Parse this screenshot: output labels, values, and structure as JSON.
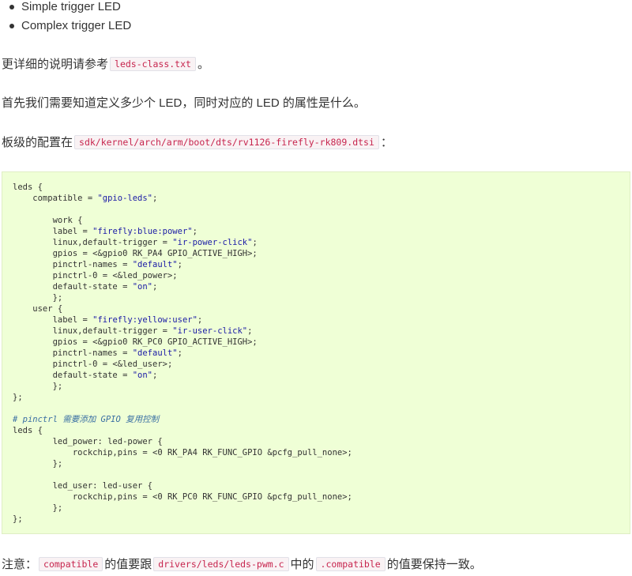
{
  "bullets": [
    "Simple trigger LED",
    "Complex trigger LED"
  ],
  "para1": {
    "before": "更详细的说明请参考",
    "code": "leds-class.txt",
    "after": "。"
  },
  "para2": {
    "text": "首先我们需要知道定义多少个 LED，同时对应的 LED 的属性是什么。"
  },
  "para3": {
    "before": "板级的配置在",
    "code": "sdk/kernel/arch/arm/boot/dts/rv1126-firefly-rk809.dtsi",
    "after": "："
  },
  "code_lines": [
    [
      {
        "t": "leds {",
        "c": ""
      }
    ],
    [
      {
        "t": "    compatible = ",
        "c": ""
      },
      {
        "t": "\"gpio-leds\"",
        "c": "str"
      },
      {
        "t": ";",
        "c": ""
      }
    ],
    [
      {
        "t": "",
        "c": ""
      }
    ],
    [
      {
        "t": "        work {",
        "c": ""
      }
    ],
    [
      {
        "t": "        label = ",
        "c": ""
      },
      {
        "t": "\"firefly:blue:power\"",
        "c": "str"
      },
      {
        "t": ";",
        "c": ""
      }
    ],
    [
      {
        "t": "        linux,default-trigger = ",
        "c": ""
      },
      {
        "t": "\"ir-power-click\"",
        "c": "str"
      },
      {
        "t": ";",
        "c": ""
      }
    ],
    [
      {
        "t": "        gpios = <&gpio0 RK_PA4 GPIO_ACTIVE_HIGH>;",
        "c": ""
      }
    ],
    [
      {
        "t": "        pinctrl-names = ",
        "c": ""
      },
      {
        "t": "\"default\"",
        "c": "str"
      },
      {
        "t": ";",
        "c": ""
      }
    ],
    [
      {
        "t": "        pinctrl-0 = <&led_power>;",
        "c": ""
      }
    ],
    [
      {
        "t": "        default-state = ",
        "c": ""
      },
      {
        "t": "\"on\"",
        "c": "str"
      },
      {
        "t": ";",
        "c": ""
      }
    ],
    [
      {
        "t": "        };",
        "c": ""
      }
    ],
    [
      {
        "t": "    user {",
        "c": ""
      }
    ],
    [
      {
        "t": "        label = ",
        "c": ""
      },
      {
        "t": "\"firefly:yellow:user\"",
        "c": "str"
      },
      {
        "t": ";",
        "c": ""
      }
    ],
    [
      {
        "t": "        linux,default-trigger = ",
        "c": ""
      },
      {
        "t": "\"ir-user-click\"",
        "c": "str"
      },
      {
        "t": ";",
        "c": ""
      }
    ],
    [
      {
        "t": "        gpios = <&gpio0 RK_PC0 GPIO_ACTIVE_HIGH>;",
        "c": ""
      }
    ],
    [
      {
        "t": "        pinctrl-names = ",
        "c": ""
      },
      {
        "t": "\"default\"",
        "c": "str"
      },
      {
        "t": ";",
        "c": ""
      }
    ],
    [
      {
        "t": "        pinctrl-0 = <&led_user>;",
        "c": ""
      }
    ],
    [
      {
        "t": "        default-state = ",
        "c": ""
      },
      {
        "t": "\"on\"",
        "c": "str"
      },
      {
        "t": ";",
        "c": ""
      }
    ],
    [
      {
        "t": "        };",
        "c": ""
      }
    ],
    [
      {
        "t": "};",
        "c": ""
      }
    ],
    [
      {
        "t": "",
        "c": ""
      }
    ],
    [
      {
        "t": "# pinctrl 需要添加 GPIO 复用控制",
        "c": "cmt"
      }
    ],
    [
      {
        "t": "leds {",
        "c": ""
      }
    ],
    [
      {
        "t": "        led_power: led-power {",
        "c": ""
      }
    ],
    [
      {
        "t": "            rockchip,pins = <0 RK_PA4 RK_FUNC_GPIO &pcfg_pull_none>;",
        "c": ""
      }
    ],
    [
      {
        "t": "        };",
        "c": ""
      }
    ],
    [
      {
        "t": "",
        "c": ""
      }
    ],
    [
      {
        "t": "        led_user: led-user {",
        "c": ""
      }
    ],
    [
      {
        "t": "            rockchip,pins = <0 RK_PC0 RK_FUNC_GPIO &pcfg_pull_none>;",
        "c": ""
      }
    ],
    [
      {
        "t": "        };",
        "c": ""
      }
    ],
    [
      {
        "t": "};",
        "c": ""
      }
    ]
  ],
  "note": {
    "before": "注意：",
    "code1": "compatible",
    "mid1": "的值要跟",
    "code2": "drivers/leds/leds-pwm.c",
    "mid2": "中的",
    "code3": ".compatible",
    "after": "的值要保持一致。"
  }
}
